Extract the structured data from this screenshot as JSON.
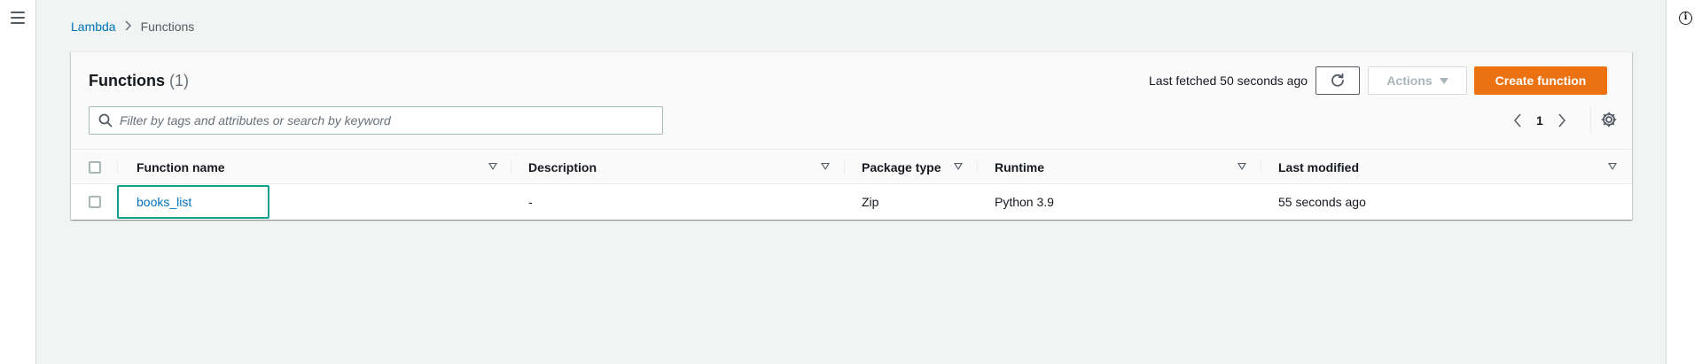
{
  "breadcrumb": {
    "items": [
      {
        "label": "Lambda",
        "link": true
      },
      {
        "label": "Functions",
        "link": false
      }
    ],
    "separator": ">"
  },
  "header": {
    "title": "Functions",
    "count": "(1)",
    "last_fetched": "Last fetched 50 seconds ago",
    "actions_label": "Actions",
    "create_label": "Create function"
  },
  "search": {
    "placeholder": "Filter by tags and attributes or search by keyword",
    "value": ""
  },
  "pagination": {
    "current_page": "1"
  },
  "table": {
    "columns": [
      "Function name",
      "Description",
      "Package type",
      "Runtime",
      "Last modified"
    ],
    "rows": [
      {
        "function_name": "books_list",
        "description": "-",
        "package_type": "Zip",
        "runtime": "Python 3.9",
        "last_modified": "55 seconds ago"
      }
    ]
  },
  "colors": {
    "primary": "#ec7211",
    "link": "#0073bb",
    "focus": "#11a28f"
  }
}
